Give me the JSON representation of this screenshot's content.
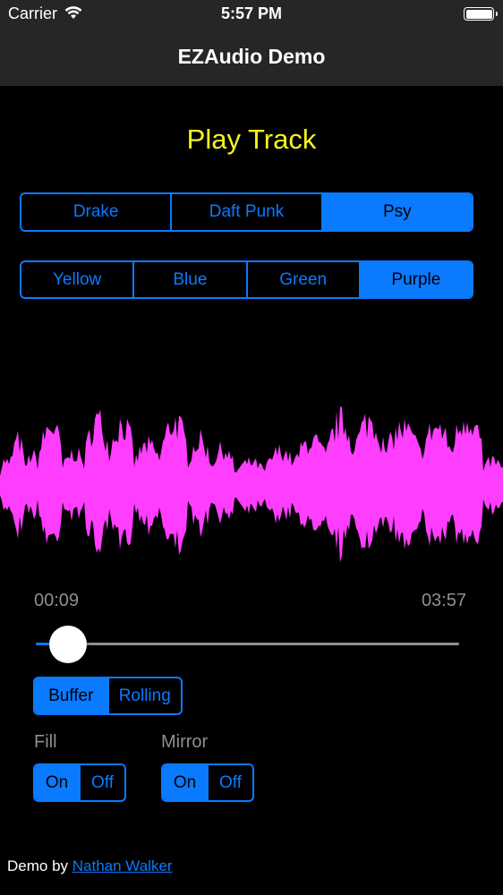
{
  "status_bar": {
    "carrier": "Carrier",
    "time": "5:57 PM",
    "battery_level": 1.0
  },
  "nav": {
    "title": "EZAudio Demo"
  },
  "play_button": {
    "label": "Play Track",
    "color": "#f7f31b"
  },
  "track_selector": {
    "options": [
      "Drake",
      "Daft Punk",
      "Psy"
    ],
    "selected": "Psy"
  },
  "color_selector": {
    "options": [
      "Yellow",
      "Blue",
      "Green",
      "Purple"
    ],
    "selected": "Purple"
  },
  "waveform": {
    "color": "#ff3dff"
  },
  "playback": {
    "elapsed": "00:09",
    "duration": "03:57",
    "progress": 0.04
  },
  "plot_type": {
    "options": [
      "Buffer",
      "Rolling"
    ],
    "selected": "Buffer"
  },
  "fill": {
    "label": "Fill",
    "options": [
      "On",
      "Off"
    ],
    "selected": "On"
  },
  "mirror": {
    "label": "Mirror",
    "options": [
      "On",
      "Off"
    ],
    "selected": "On"
  },
  "footer": {
    "prefix": "Demo by ",
    "author": "Nathan Walker"
  },
  "colors": {
    "accent": "#0a7afe",
    "nav_background": "#262626",
    "background": "#000000",
    "muted": "#8e8e93"
  }
}
